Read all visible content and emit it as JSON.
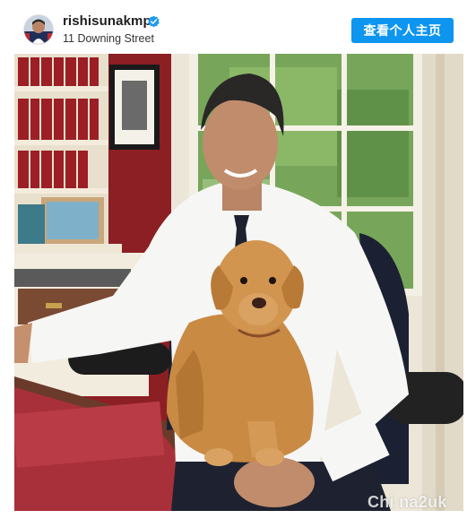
{
  "post": {
    "account": {
      "username": "rishisunakmp",
      "verified": true,
      "location": "11 Downing Street"
    },
    "profile_button_label": "查看个人主页",
    "photo": {
      "alt": "Man in white shirt and dark tie sitting at a desk holding a fox red labrador puppy"
    }
  },
  "watermark": "Chi na2uk",
  "colors": {
    "button_bg": "#0d95f0",
    "verified_badge": "#1d9bf0",
    "wall_red": "#8c1f24",
    "desk_red": "#a8303a",
    "puppy": "#c98a44",
    "window_green": "#6a9a4d"
  },
  "icons": {
    "verified": "verified-check-icon",
    "avatar": "profile-avatar"
  }
}
